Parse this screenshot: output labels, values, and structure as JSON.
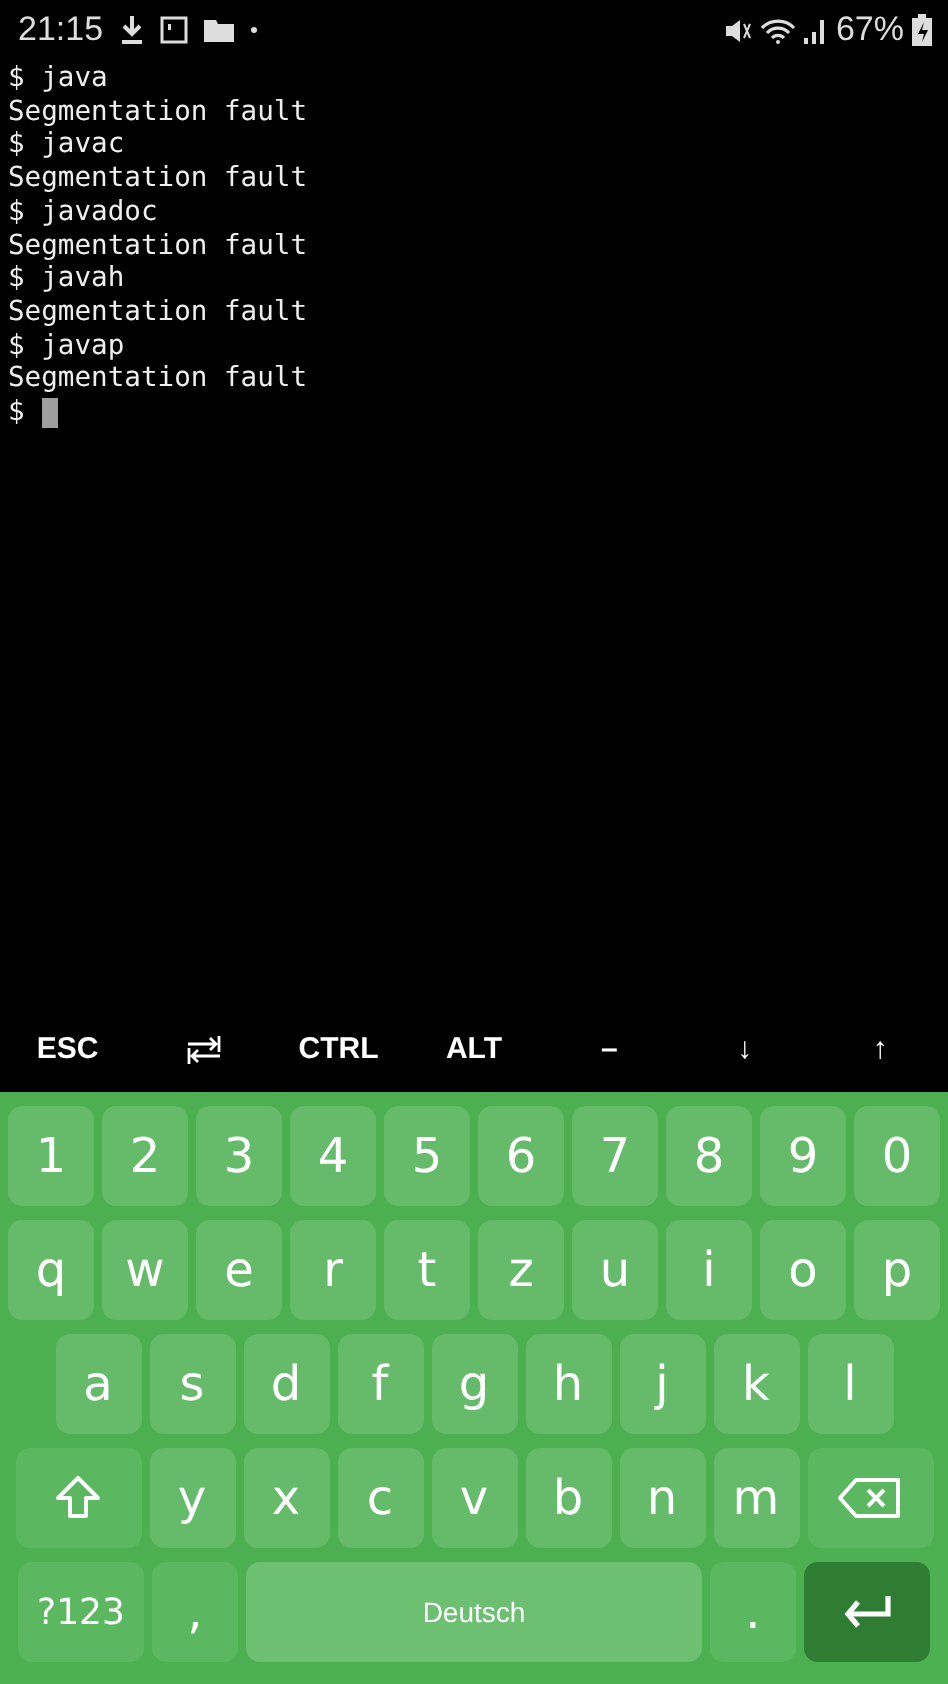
{
  "status_bar": {
    "time": "21:15",
    "battery": "67%"
  },
  "terminal": {
    "lines": [
      "$ java",
      "Segmentation fault",
      "$ javac",
      "Segmentation fault",
      "$ javadoc",
      "Segmentation fault",
      "$ javah",
      "Segmentation fault",
      "$ javap",
      "Segmentation fault"
    ],
    "prompt": "$ "
  },
  "extra_keys": [
    {
      "kind": "text",
      "label": "ESC"
    },
    {
      "kind": "tab"
    },
    {
      "kind": "text",
      "label": "CTRL"
    },
    {
      "kind": "text",
      "label": "ALT"
    },
    {
      "kind": "text",
      "label": "–"
    },
    {
      "kind": "text",
      "label": "↓"
    },
    {
      "kind": "text",
      "label": "↑"
    }
  ],
  "keyboard": {
    "number_row": [
      {
        "kind": "char",
        "label": "1"
      },
      {
        "kind": "char",
        "label": "2"
      },
      {
        "kind": "char",
        "label": "3"
      },
      {
        "kind": "char",
        "label": "4"
      },
      {
        "kind": "char",
        "label": "5"
      },
      {
        "kind": "char",
        "label": "6"
      },
      {
        "kind": "char",
        "label": "7"
      },
      {
        "kind": "char",
        "label": "8"
      },
      {
        "kind": "char",
        "label": "9"
      },
      {
        "kind": "char",
        "label": "0"
      }
    ],
    "letter_row_1": [
      {
        "kind": "char",
        "label": "q"
      },
      {
        "kind": "char",
        "label": "w"
      },
      {
        "kind": "char",
        "label": "e"
      },
      {
        "kind": "char",
        "label": "r"
      },
      {
        "kind": "char",
        "label": "t"
      },
      {
        "kind": "char",
        "label": "z"
      },
      {
        "kind": "char",
        "label": "u"
      },
      {
        "kind": "char",
        "label": "i"
      },
      {
        "kind": "char",
        "label": "o"
      },
      {
        "kind": "char",
        "label": "p"
      }
    ],
    "letter_row_2": [
      {
        "kind": "char",
        "label": "a"
      },
      {
        "kind": "char",
        "label": "s"
      },
      {
        "kind": "char",
        "label": "d"
      },
      {
        "kind": "char",
        "label": "f"
      },
      {
        "kind": "char",
        "label": "g"
      },
      {
        "kind": "char",
        "label": "h"
      },
      {
        "kind": "char",
        "label": "j"
      },
      {
        "kind": "char",
        "label": "k"
      },
      {
        "kind": "char",
        "label": "l"
      }
    ],
    "letter_row_3": [
      {
        "kind": "shift"
      },
      {
        "kind": "char",
        "label": "y"
      },
      {
        "kind": "char",
        "label": "x"
      },
      {
        "kind": "char",
        "label": "c"
      },
      {
        "kind": "char",
        "label": "v"
      },
      {
        "kind": "char",
        "label": "b"
      },
      {
        "kind": "char",
        "label": "n"
      },
      {
        "kind": "char",
        "label": "m"
      },
      {
        "kind": "backspace"
      }
    ],
    "bottom_row": [
      {
        "kind": "symbols",
        "label": "?123"
      },
      {
        "kind": "punct",
        "label": ","
      },
      {
        "kind": "space",
        "label": "Deutsch"
      },
      {
        "kind": "punct",
        "label": "."
      },
      {
        "kind": "enter"
      }
    ]
  }
}
